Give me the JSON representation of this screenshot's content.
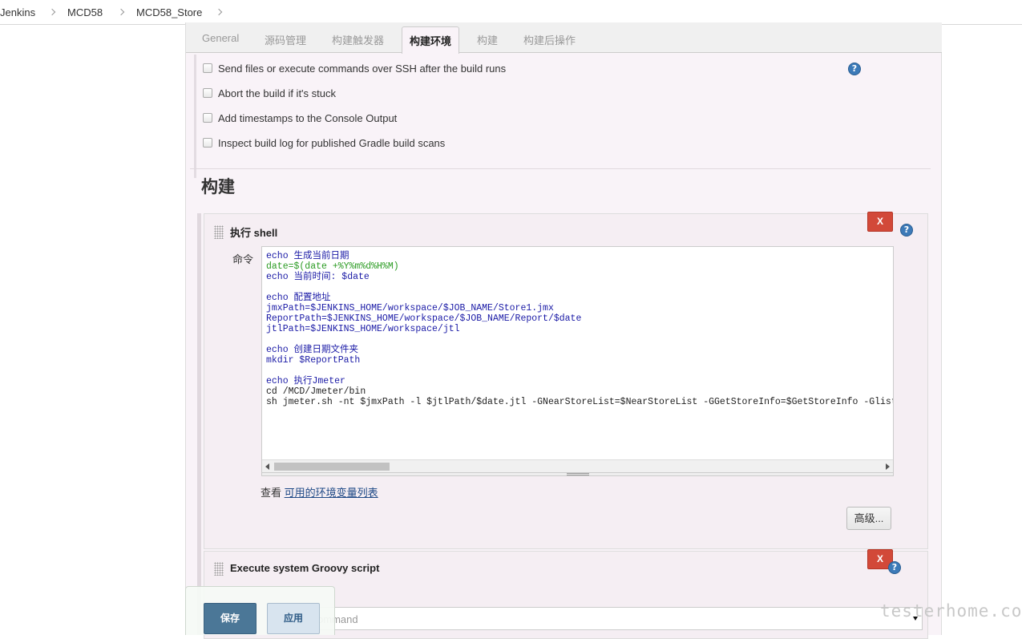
{
  "breadcrumb": [
    "Jenkins",
    "MCD58",
    "MCD58_Store"
  ],
  "tabs": [
    {
      "label": "General"
    },
    {
      "label": "源码管理"
    },
    {
      "label": "构建触发器"
    },
    {
      "label": "构建环境"
    },
    {
      "label": "构建"
    },
    {
      "label": "构建后操作"
    }
  ],
  "active_tab": "构建环境",
  "build_env_options": [
    {
      "label": "Send files or execute commands over SSH after the build runs",
      "checked": false
    },
    {
      "label": "Abort the build if it's stuck",
      "checked": false
    },
    {
      "label": "Add timestamps to the Console Output",
      "checked": false
    },
    {
      "label": "Inspect build log for published Gradle build scans",
      "checked": false
    }
  ],
  "section_title": "构建",
  "shell_step": {
    "title": "执行 shell",
    "delete_label": "X",
    "command_label": "命令",
    "command_lines": [
      "echo 生成当前日期",
      "date=$(date +%Y%m%d%H%M)",
      "echo 当前时间: $date",
      "",
      "echo 配置地址",
      "jmxPath=$JENKINS_HOME/workspace/$JOB_NAME/Store1.jmx",
      "ReportPath=$JENKINS_HOME/workspace/$JOB_NAME/Report/$date",
      "jtlPath=$JENKINS_HOME/workspace/jtl",
      "",
      "echo 创建日期文件夹",
      "mkdir $ReportPath",
      "",
      "echo 执行Jmeter",
      "cd /MCD/Jmeter/bin",
      "sh jmeter.sh -nt $jmxPath -l $jtlPath/$date.jtl -GNearStoreList=$NearStoreList -GGetStoreInfo=$GetStoreInfo -GlistbyHoli"
    ],
    "env_prefix": "查看",
    "env_link": "可用的环境变量列表",
    "advanced_label": "高级..."
  },
  "groovy_step": {
    "title": "Execute system Groovy script",
    "delete_label": "X",
    "select_value": "Groovy command"
  },
  "footer": {
    "save_label": "保存",
    "apply_label": "应用"
  },
  "watermark": "testerhome.com",
  "colors": {
    "delete_button": "#d24939",
    "save_button": "#4b7797",
    "help_icon": "#3c7ab8",
    "panel_bg": "#f9f3f8"
  }
}
